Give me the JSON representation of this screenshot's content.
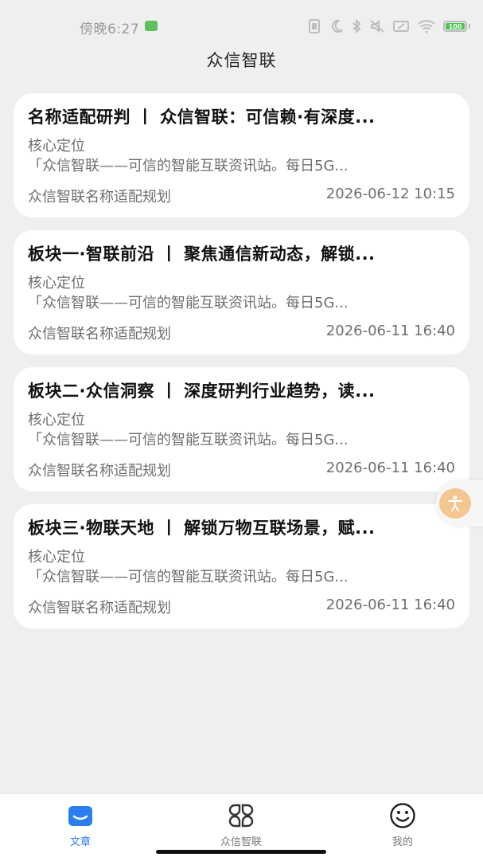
{
  "status_bar": {
    "time": "傍晚6:27",
    "battery": "100"
  },
  "header": {
    "title": "众信智联"
  },
  "articles": [
    {
      "title": "名称适配研判 丨 众信智联：可信赖·有深度...",
      "label": "核心定位",
      "desc": "「众信智联——可信的智能互联资讯站。每日5G...",
      "source": "众信智联名称适配规划",
      "date": "2026-06-12 10:15"
    },
    {
      "title": "板块一·智联前沿 丨 聚焦通信新动态，解锁...",
      "label": "核心定位",
      "desc": "「众信智联——可信的智能互联资讯站。每日5G...",
      "source": "众信智联名称适配规划",
      "date": "2026-06-11 16:40"
    },
    {
      "title": "板块二·众信洞察 丨 深度研判行业趋势，读...",
      "label": "核心定位",
      "desc": "「众信智联——可信的智能互联资讯站。每日5G...",
      "source": "众信智联名称适配规划",
      "date": "2026-06-11 16:40"
    },
    {
      "title": "板块三·物联天地 丨 解锁万物互联场景，赋...",
      "label": "核心定位",
      "desc": "「众信智联——可信的智能互联资讯站。每日5G...",
      "source": "众信智联名称适配规划",
      "date": "2026-06-11 16:40"
    }
  ],
  "tabbar": {
    "tabs": [
      {
        "label": "文章",
        "icon": "article-icon",
        "active": true
      },
      {
        "label": "众信智联",
        "icon": "grid-icon",
        "active": false
      },
      {
        "label": "我的",
        "icon": "smiley-icon",
        "active": false
      }
    ]
  },
  "colors": {
    "accent": "#2a7ef0",
    "background": "#efefef",
    "card": "#ffffff",
    "float_button": "#f4c690"
  }
}
